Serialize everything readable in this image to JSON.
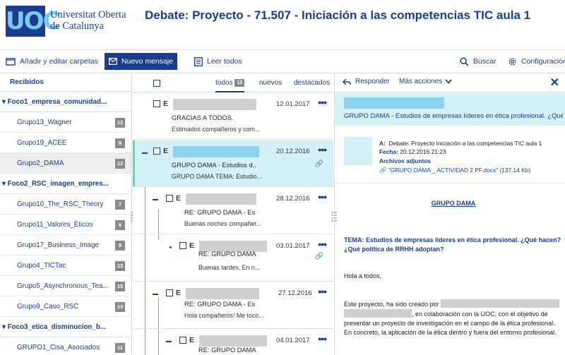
{
  "brand": {
    "logo_mark": "UOC",
    "name_line1": "Universitat Oberta",
    "name_line2": "de Catalunya"
  },
  "page_title": "Debate: Proyecto - 71.507 - Iniciación a las competencias TIC aula 1",
  "toolbar": {
    "folders_label": "Añadir y editar carpetas",
    "new_message_label": "Nuevo mensaje",
    "read_all_label": "Leer todos",
    "search_label": "Buscar",
    "settings_label": "Configuración"
  },
  "sidebar": {
    "header": "Recibidos",
    "focus1": "Foco1_empresa_comunidad...",
    "g13": {
      "label": "Grupo13_Wagner",
      "count": "12"
    },
    "g19": {
      "label": "Grupo19_ACEE",
      "count": "9"
    },
    "g2": {
      "label": "Grupo2_DAMA",
      "count": "12"
    },
    "focus2": "Foco2_RSC_imagen_empres...",
    "g10": {
      "label": "Grupo10_The_RSC_Theory",
      "count": "7"
    },
    "g11": {
      "label": "Grupo11_Valores_Éticos",
      "count": "6"
    },
    "g17": {
      "label": "Grupo17_Business_Image",
      "count": "9"
    },
    "g4": {
      "label": "Grupo4_TICTac",
      "count": "13"
    },
    "g5": {
      "label": "Grupo5_Asynchronous_Tea...",
      "count": "15"
    },
    "g9": {
      "label": "Grupo9_Caso_RSC",
      "count": "13"
    },
    "focus3": "Foco3_etica_disminucion_b...",
    "g1": {
      "label": "GRUPO1_Cisa_Asociados",
      "count": "11"
    }
  },
  "message_list": {
    "tabs": {
      "all": "todos",
      "all_count": "12",
      "new": "nuevos",
      "featured": "destacados"
    },
    "m1": {
      "initial": "E",
      "date": "12.01.2017",
      "subject": "GRACIAS A TODOS.",
      "preview": "Estimados compañeros y com..."
    },
    "m2": {
      "initial": "E",
      "date": "20.12.2016",
      "subject": "GRUPO DAMA - Estudios d...",
      "preview": "GRUPO DAMA   TEMA: Estudio..."
    },
    "m3": {
      "initial": "E",
      "date": "28.12.2016",
      "subject": "RE: GRUPO DAMA - Es...",
      "preview": "Buenas noches compañer..."
    },
    "m4": {
      "initial": "E",
      "date": "03.01.2017",
      "subject": "RE: GRUPO DAMA...",
      "preview": "Buenas tardes, En n..."
    },
    "m5": {
      "initial": "E",
      "date": "27.12.2016",
      "subject": "RE: GRUPO DAMA - Es...",
      "preview": "Hola compañeros! Me toco..."
    },
    "m6": {
      "initial": "E",
      "date": "04.01.2017",
      "subject": "RE: GRUPO DAMA...",
      "preview": ""
    }
  },
  "reader": {
    "reply_label": "Responder",
    "more_actions_label": "Más acciones",
    "subject": "GRUPO DAMA - Estudios de empresas líderes en ética profesional. ¿Qué ...",
    "to_label": "A:",
    "to_value": "Debate: Proyecto Iniciación a las competencias TIC aula 1",
    "date_label": "Fecha:",
    "date_value": "20.12.2016 21:23",
    "attachments_label": "Archivos adjuntos",
    "attachment_name": "\"GRUPO DAMA _ ACTIVIDAD 2 PF.docx\"",
    "attachment_size": "(137.14 Kb)",
    "body_title": "GRUPO DAMA",
    "body_tema": "TEMA: Estudios de empresas líderes en ética profesional. ¿Qué hacen? ¿Qué política de RRHH adoptan?",
    "body_greeting": "Hola a todos,",
    "body_p1_start": "Este proyecto, ha sido creado por",
    "body_p1_rest": ", en colaboración con la UOC, con el objetivo de presentar un proyecto de investigación en el campo de la ética profesional. En concreto, la aplicación de la ética dentro y fuera del entorno profesional."
  },
  "colors": {
    "brand": "#1b3c8c",
    "accent_light": "#7ec8f0",
    "selected_bg": "#d5f1f8",
    "badge": "#8a8a8a"
  }
}
